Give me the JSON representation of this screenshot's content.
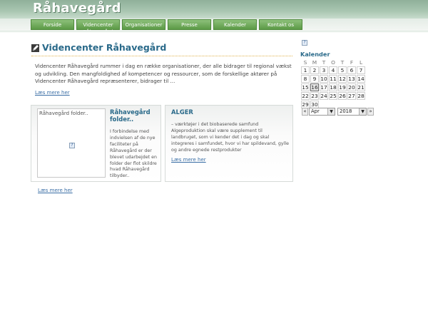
{
  "site": {
    "logo": "Råhavegård"
  },
  "nav": [
    {
      "label": "Forside"
    },
    {
      "label": "Videncenter Råhavegård"
    },
    {
      "label": "Organisationer"
    },
    {
      "label": "Presse"
    },
    {
      "label": "Kalender"
    },
    {
      "label": "Kontakt os"
    }
  ],
  "main": {
    "title": "Videncenter Råhavegård",
    "intro": "Videncenter Råhavegård rummer i dag en række organisationer, der alle bidrager til regional vækst og udvikling. Den mangfoldighed af kompetencer og ressourcer, som de forskellige aktører på Videncenter Råhavegård repræsenterer, bidrager til ...",
    "intro_more": "Læs mere her",
    "folder": {
      "image_alt": "Råhavegård folder..",
      "title": "Råhavegård folder..",
      "text": "I forbindelse med indvielsen af de nye faciliteter på Råhavegård er der blevet udarbejdet en folder der flot skildre hvad Råhavegård tilbyder..",
      "more": "Læs mere her"
    },
    "alger": {
      "title": "ALGER",
      "text": "– værktøjer i det biobaserede samfund Algeproduktion skal være supplement til landbruget, som vi kender det i dag og skal integreres i samfundet, hvor vi har spildevand, gylle og andre egnede restprodukter",
      "more": "Læs mere her"
    }
  },
  "calendar": {
    "title": "Kalender",
    "weekdays": [
      "S",
      "M",
      "T",
      "O",
      "T",
      "F",
      "L"
    ],
    "weeks": [
      [
        "1",
        "2",
        "3",
        "4",
        "5",
        "6",
        "7"
      ],
      [
        "8",
        "9",
        "10",
        "11",
        "12",
        "13",
        "14"
      ],
      [
        "15",
        "16",
        "17",
        "18",
        "19",
        "20",
        "21"
      ],
      [
        "22",
        "23",
        "24",
        "25",
        "26",
        "27",
        "28"
      ],
      [
        "29",
        "30",
        "",
        "",
        "",
        "",
        ""
      ]
    ],
    "today": "16",
    "prev": "«",
    "next": "»",
    "month": "Apr",
    "year": "2018",
    "dropdown_arrow": "▼"
  }
}
